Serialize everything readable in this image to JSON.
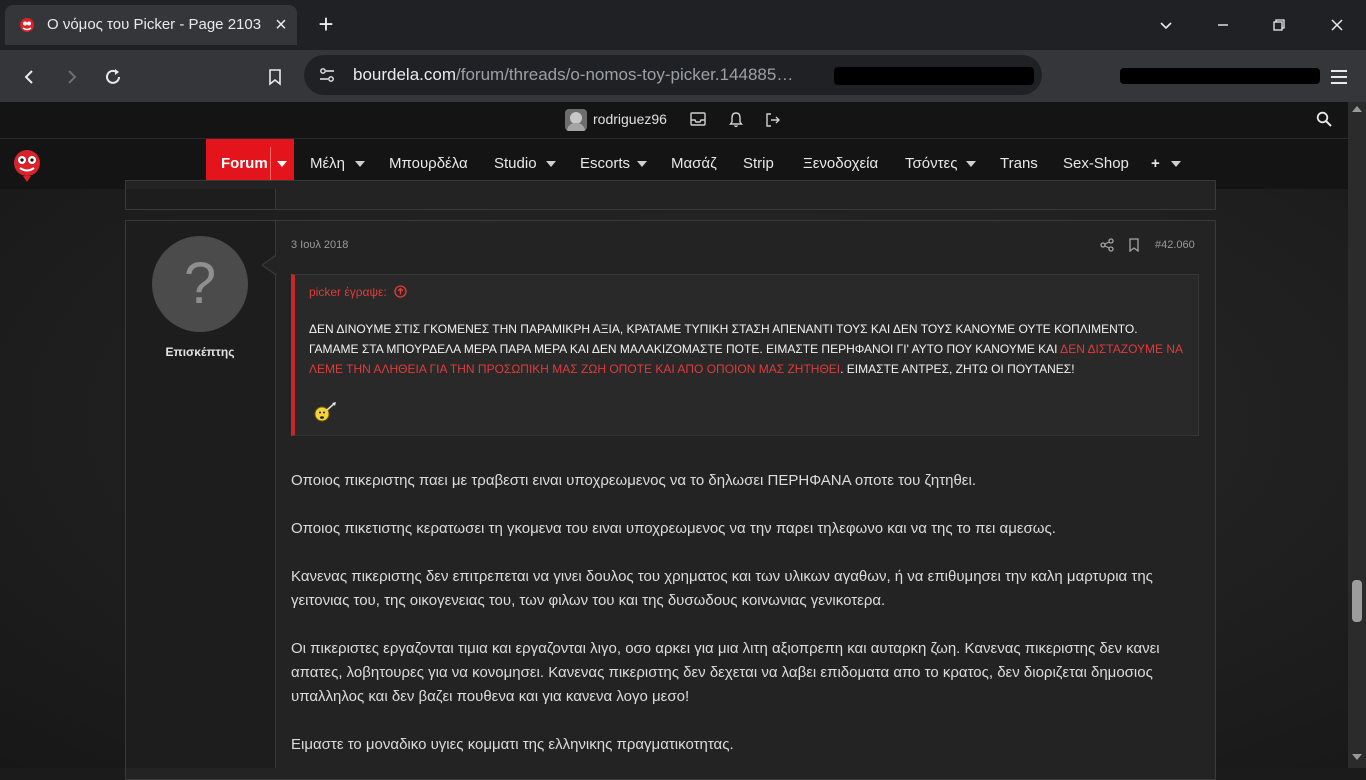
{
  "browser": {
    "tab_title": "Ο νόμος του Picker - Page 2103",
    "url_domain": "bourdela.com",
    "url_path": "/forum/threads/o-nomos-toy-picker.144885…"
  },
  "userbar": {
    "username": "rodriguez96"
  },
  "nav": {
    "items": [
      {
        "label": "Forum"
      },
      {
        "label": "Μέλη"
      },
      {
        "label": "Μπουρδέλα"
      },
      {
        "label": "Studio"
      },
      {
        "label": "Escorts"
      },
      {
        "label": "Μασάζ"
      },
      {
        "label": "Strip"
      },
      {
        "label": "Ξενοδοχεία"
      },
      {
        "label": "Τσόντες"
      },
      {
        "label": "Trans"
      },
      {
        "label": "Sex-Shop"
      },
      {
        "label": "+"
      }
    ],
    "accent_color": "#e3141b"
  },
  "post": {
    "author": "Επισκέπτης",
    "avatar_glyph": "?",
    "date": "3 Ιουλ 2018",
    "number": "#42.060",
    "quote": {
      "author_line": "picker έγραψε:",
      "text_1": "ΔΕΝ ΔΙΝΟΥΜΕ ΣΤΙΣ ΓΚΟΜΕΝΕΣ ΤΗΝ ΠΑΡΑΜΙΚΡΗ ΑΞΙΑ, ΚΡΑΤΑΜΕ ΤΥΠΙΚΗ ΣΤΑΣΗ ΑΠΕΝΑΝΤΙ ΤΟΥΣ ΚΑΙ ΔΕΝ ΤΟΥΣ ΚΑΝΟΥΜΕ ΟΥΤΕ ΚΟΠΛΙΜΕΝΤΟ. ΓΑΜΑΜΕ ΣΤΑ ΜΠΟΥΡΔΕΛΑ ΜΕΡΑ ΠΑΡΑ ΜΕΡΑ ΚΑΙ ΔΕΝ ΜΑΛΑΚΙΖΟΜΑΣΤΕ ΠΟΤΕ. ΕΙΜΑΣΤΕ ΠΕΡΗΦΑΝΟΙ ΓΙ' ΑΥΤΟ ΠΟΥ ΚΑΝΟΥΜΕ ΚΑΙ ",
      "text_highlight": "ΔΕΝ ΔΙΣΤΑΖΟΥΜΕ ΝΑ ΛΕΜΕ ΤΗΝ ΑΛΗΘΕΙΑ ΓΙΑ ΤΗΝ ΠΡΟΣΩΠΙΚΗ ΜΑΣ ΖΩΗ ΟΠΟΤΕ ΚΑΙ ΑΠΟ ΟΠΟΙΟΝ ΜΑΣ ΖΗΤΗΘΕΙ",
      "text_2": ". ΕΙΜΑΣΤΕ ΑΝΤΡΕΣ, ΖΗΤΩ ΟΙ ΠΟΥΤΑΝΕΣ!"
    },
    "paragraphs": [
      "Οποιος πικεριστης παει με τραβεστι ειναι υποχρεωμενος να το δηλωσει ΠΕΡΗΦΑΝΑ οποτε του ζητηθει.",
      "Οποιος πικετιστης κερατωσει τη γκομενα του ειναι υποχρεωμενος να την παρει τηλεφωνο και να της το πει αμεσως.",
      "Κανενας πικεριστης δεν επιτρεπεται να γινει δουλος του χρηματος και των υλικων αγαθων, ή να επιθυμησει την καλη μαρτυρια της γειτονιας του, της οικογενειας του, των φιλων του και της δυσωδους κοινωνιας γενικοτερα.",
      "Οι πικεριστες εργαζονται τιμια και εργαζονται λιγο, οσο αρκει για μια λιτη αξιοπρεπη και αυταρκη ζωη. Κανενας πικεριστης δεν κανει απατες, λοβητουρες για να κονομησει. Κανενας πικεριστης δεν δεχεται να λαβει επιδοματα απο το κρατος, δεν διοριζεται δημοσιος υπαλληλος και δεν βαζει πουθενα και για κανενα λογο μεσο!",
      "Ειμαστε το μοναδικο υγιες κομματι της ελληνικης πραγματικοτητας."
    ]
  }
}
